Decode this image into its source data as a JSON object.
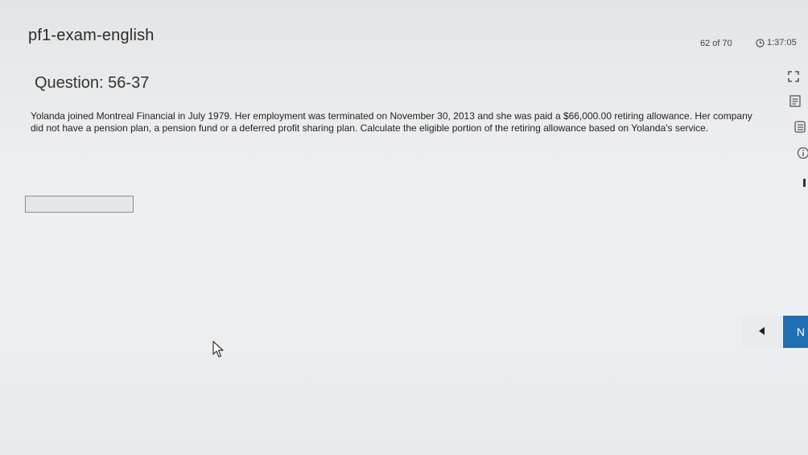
{
  "app": {
    "title": "pf1-exam-english"
  },
  "header": {
    "progress": "62 of 70",
    "timer": "1:37:05"
  },
  "question": {
    "title": "Question: 56-37",
    "body": "Yolanda joined Montreal Financial in July 1979. Her employment was terminated on November 30, 2013 and she was paid a $66,000.00 retiring allowance. Her company did not have a pension plan, a pension fund or a deferred profit sharing plan. Calculate the eligible portion of the retiring allowance based on Yolanda's service."
  },
  "answer": {
    "value": ""
  },
  "navigation": {
    "next_label": "N"
  },
  "sidebar_icons": [
    "fullscreen-icon",
    "calculator-icon",
    "notes-icon",
    "info-icon"
  ],
  "colors": {
    "accent": "#1f6fb2",
    "background": "#ecedef"
  }
}
